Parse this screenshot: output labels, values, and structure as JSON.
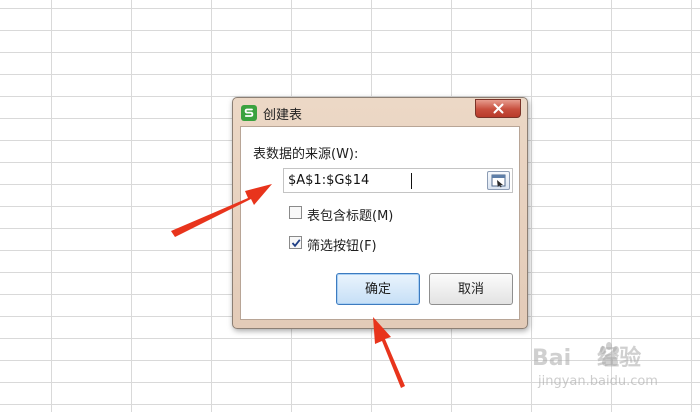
{
  "dialog": {
    "title": "创建表",
    "source_label": "表数据的来源(W):",
    "range_value": "$A$1:$G$14",
    "header_checkbox_label": "表包含标题(M)",
    "header_checkbox_checked": false,
    "filter_checkbox_label": "筛选按钮(F)",
    "filter_checkbox_checked": true,
    "ok_label": "确定",
    "cancel_label": "取消"
  },
  "icons": {
    "app": "wps-spreadsheet-icon",
    "close": "close-icon",
    "range_select": "range-select-icon"
  },
  "colors": {
    "arrow": "#e8341c",
    "close_button": "#c74e3d",
    "ok_border": "#3d7bbf"
  },
  "watermark": {
    "main_left": "Bai",
    "main_right": "经验",
    "sub": "jingyan.baidu.com"
  }
}
